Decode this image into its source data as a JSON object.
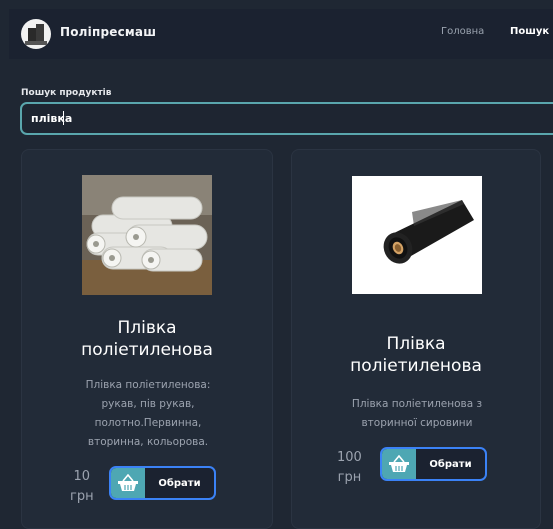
{
  "header": {
    "brand": "Поліпресмаш",
    "nav": {
      "home": "Головна",
      "search": "Пошук"
    }
  },
  "search": {
    "label": "Пошук продуктів",
    "value": "плівка"
  },
  "products": [
    {
      "title_line1": "Плівка",
      "title_line2": "поліетиленова",
      "desc_lines": [
        "Плівка поліетиленова:",
        "рукав, пів рукав,",
        "полотно.Первинна,",
        "вторинна, кольорова."
      ],
      "price_value": "10",
      "price_unit": "грн",
      "button": "Обрати"
    },
    {
      "title_line1": "Плівка",
      "title_line2": "поліетиленова",
      "desc_lines": [
        "Плівка поліетиленова з",
        "вторинної сировини"
      ],
      "price_value": "100",
      "price_unit": "грн",
      "button": "Обрати"
    }
  ],
  "colors": {
    "accent": "#3b82f6",
    "teal": "#4ea7b3",
    "search_border": "#5aa6ad",
    "background": "#1f2733"
  }
}
